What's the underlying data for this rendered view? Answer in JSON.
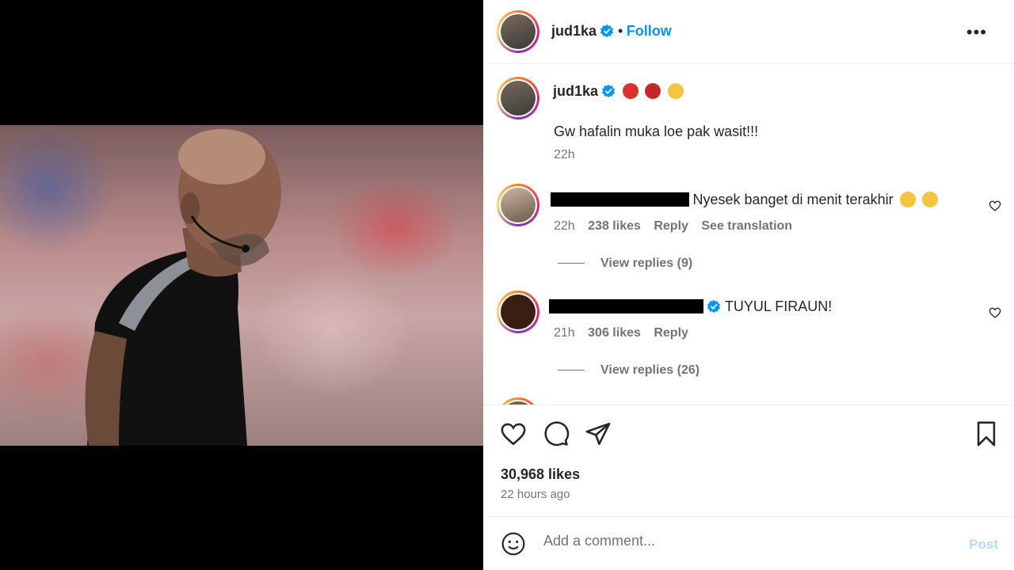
{
  "header": {
    "username": "jud1ka",
    "separator": "•",
    "follow_label": "Follow",
    "more_label": "•••"
  },
  "caption": {
    "username": "jud1ka",
    "text": "Gw hafalin muka loe pak wasit!!!",
    "time": "22h"
  },
  "comments": [
    {
      "text": "Nyesek banget di menit terakhir",
      "time": "22h",
      "likes": "238 likes",
      "reply_label": "Reply",
      "translate_label": "See translation",
      "view_replies": "View replies (9)"
    },
    {
      "text": "TUYUL FIRAUN!",
      "time": "21h",
      "likes": "306 likes",
      "reply_label": "Reply",
      "view_replies": "View replies (26)"
    }
  ],
  "post": {
    "likes": "30,968 likes",
    "time_ago": "22 hours ago"
  },
  "add_comment": {
    "placeholder": "Add a comment...",
    "post_label": "Post"
  },
  "colors": {
    "accent": "#0095f6",
    "text": "#262626",
    "muted": "#737373",
    "post_disabled": "#b3dbff"
  },
  "icons": [
    "verified-badge-icon",
    "more-options-icon",
    "heart-icon",
    "comment-icon",
    "share-icon",
    "bookmark-icon",
    "emoji-icon"
  ]
}
